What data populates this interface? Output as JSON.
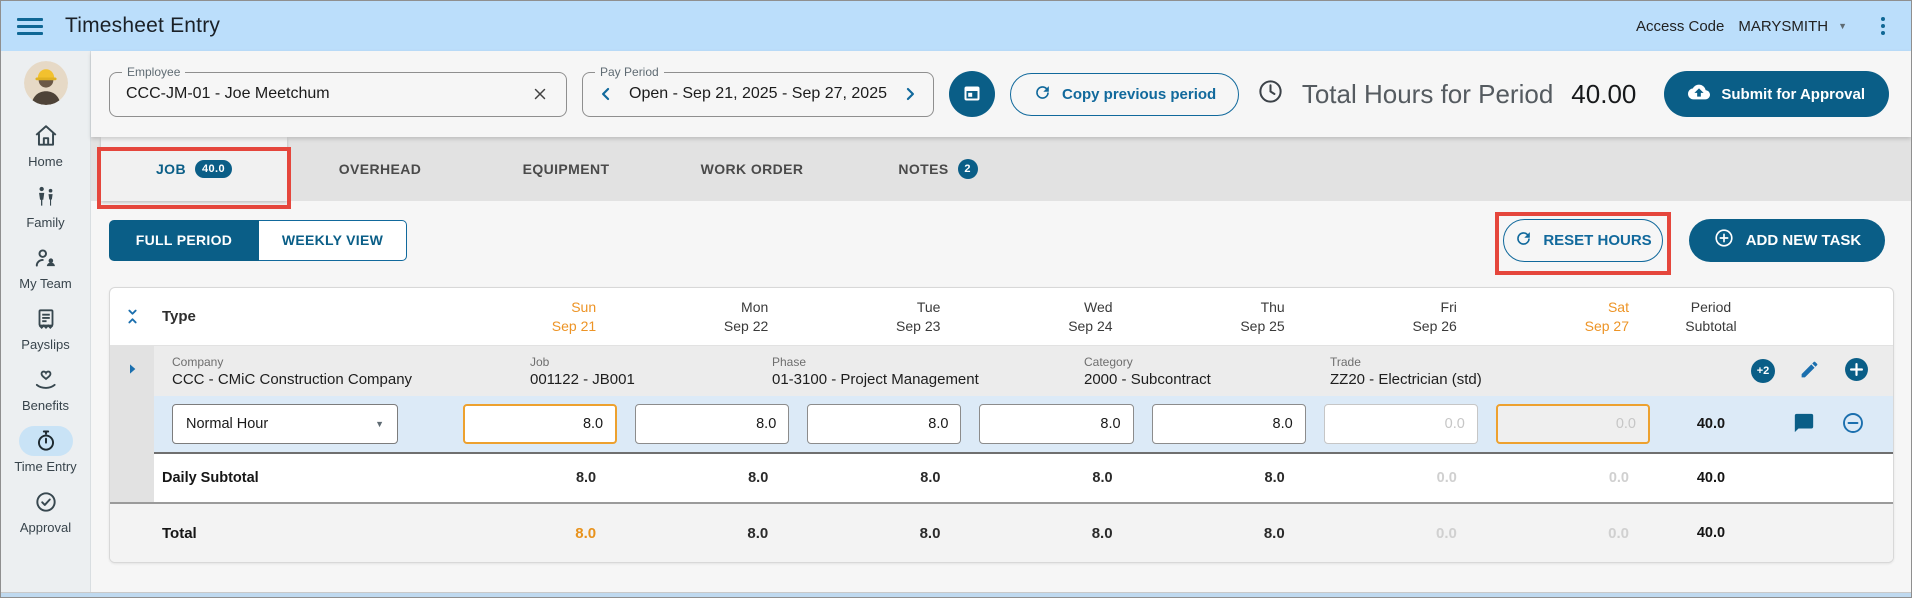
{
  "app_bar": {
    "title": "Timesheet Entry",
    "access_code_label": "Access Code",
    "access_code_value": "MARYSMITH"
  },
  "sidebar": {
    "items": [
      {
        "label": "Home"
      },
      {
        "label": "Family"
      },
      {
        "label": "My Team"
      },
      {
        "label": "Payslips"
      },
      {
        "label": "Benefits"
      },
      {
        "label": "Time Entry",
        "active": true
      },
      {
        "label": "Approval"
      }
    ]
  },
  "filters": {
    "employee": {
      "label": "Employee",
      "value": "CCC-JM-01 - Joe Meetchum"
    },
    "pay_period": {
      "label": "Pay Period",
      "value": "Open - Sep 21, 2025 - Sep 27, 2025"
    },
    "copy_previous_label": "Copy previous period",
    "total_hours_label": "Total Hours for Period",
    "total_hours_value": "40.00",
    "submit_label": "Submit for Approval"
  },
  "tabs": {
    "job": {
      "label": "JOB",
      "badge": "40.0"
    },
    "overhead": {
      "label": "OVERHEAD"
    },
    "equipment": {
      "label": "EQUIPMENT"
    },
    "work_order": {
      "label": "WORK ORDER"
    },
    "notes": {
      "label": "NOTES",
      "badge": "2"
    }
  },
  "toolbar": {
    "full_period": "FULL PERIOD",
    "weekly_view": "WEEKLY VIEW",
    "reset_hours": "RESET HOURS",
    "add_new_task": "ADD NEW TASK"
  },
  "table": {
    "type_header": "Type",
    "days": [
      {
        "name": "Sun",
        "date": "Sep 21",
        "weekend": true
      },
      {
        "name": "Mon",
        "date": "Sep 22",
        "weekend": false
      },
      {
        "name": "Tue",
        "date": "Sep 23",
        "weekend": false
      },
      {
        "name": "Wed",
        "date": "Sep 24",
        "weekend": false
      },
      {
        "name": "Thu",
        "date": "Sep 25",
        "weekend": false
      },
      {
        "name": "Fri",
        "date": "Sep 26",
        "weekend": false
      },
      {
        "name": "Sat",
        "date": "Sep 27",
        "weekend": true
      }
    ],
    "period_header_line1": "Period",
    "period_header_line2": "Subtotal",
    "task": {
      "fields": {
        "company": {
          "label": "Company",
          "value": "CCC - CMiC Construction Company"
        },
        "job": {
          "label": "Job",
          "value": "001122 - JB001"
        },
        "phase": {
          "label": "Phase",
          "value": "01-3100 - Project Management"
        },
        "category": {
          "label": "Category",
          "value": "2000 - Subcontract"
        },
        "trade": {
          "label": "Trade",
          "value": "ZZ20 - Electrician (std)"
        }
      },
      "more_badge": "+2",
      "hour_type": "Normal Hour",
      "hours": [
        "8.0",
        "8.0",
        "8.0",
        "8.0",
        "8.0",
        "0.0",
        "0.0"
      ],
      "subtotal": "40.0"
    },
    "daily_subtotal": {
      "label": "Daily Subtotal",
      "values": [
        "8.0",
        "8.0",
        "8.0",
        "8.0",
        "8.0",
        "0.0",
        "0.0"
      ],
      "total": "40.0"
    },
    "total": {
      "label": "Total",
      "values": [
        "8.0",
        "8.0",
        "8.0",
        "8.0",
        "8.0",
        "0.0",
        "0.0"
      ],
      "total": "40.0"
    }
  },
  "colors": {
    "brand_blue": "#0A5E87",
    "link_blue": "#11699C",
    "appbar_blue": "#BBDEFB",
    "weekend_orange": "#ED9426",
    "annotation_red": "#E5463C",
    "input_row_blue": "#DCEAF7"
  }
}
